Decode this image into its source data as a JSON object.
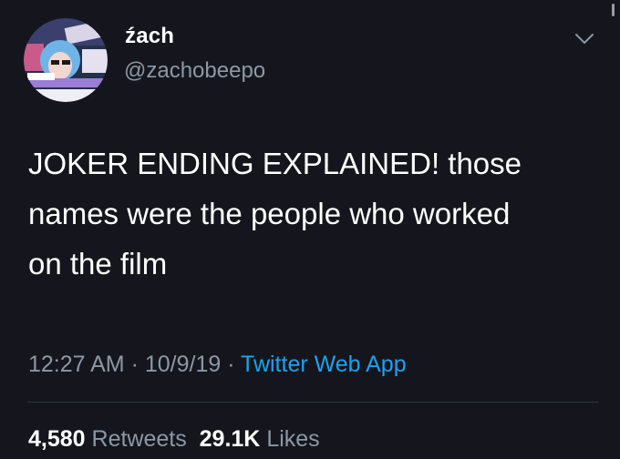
{
  "user": {
    "display_name": "źach",
    "handle": "@zachobeepo"
  },
  "tweet": {
    "text": "JOKER ENDING EXPLAINED! those\nnames were the people who worked\non the film"
  },
  "meta": {
    "time": "12:27 AM",
    "sep1": " · ",
    "date": "10/9/19",
    "sep2": " · ",
    "source": "Twitter Web App"
  },
  "stats": {
    "retweets_count": "4,580",
    "retweets_label": "Retweets",
    "likes_count": "29.1K",
    "likes_label": "Likes"
  },
  "icons": {
    "more": "chevron-down-icon"
  },
  "colors": {
    "background": "#15161d",
    "text": "#ffffff",
    "muted": "#8b98a5",
    "link": "#1da1f2",
    "divider": "#2c3640"
  }
}
